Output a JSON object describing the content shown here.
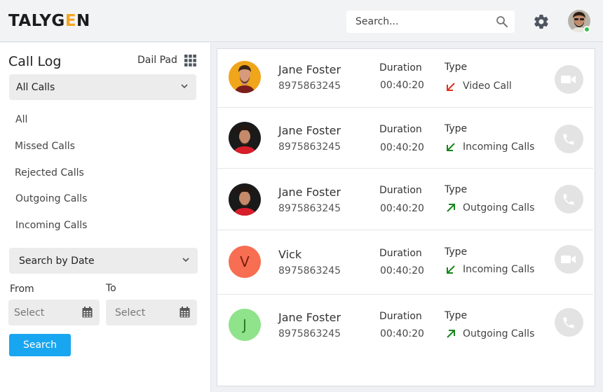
{
  "header": {
    "logo_pre": "TALYG",
    "logo_accent": "E",
    "logo_post": "N",
    "search_placeholder": "Search..."
  },
  "sidebar": {
    "title": "Call Log",
    "dialpad_label": "Dail Pad",
    "call_filter_selected": "All Calls",
    "filters": [
      "All",
      "Missed Calls",
      "Rejected Calls",
      "Outgoing Calls",
      "Incoming Calls"
    ],
    "date_filter_selected": "Search by Date",
    "from_label": "From",
    "to_label": "To",
    "from_placeholder": "Select",
    "to_placeholder": "Select",
    "search_button": "Search"
  },
  "calls": [
    {
      "name": "Jane Foster",
      "phone": "8975863245",
      "duration_label": "Duration",
      "duration": "00:40:20",
      "type_label": "Type",
      "type": "Video Call",
      "arrow": "missed",
      "action_icon": "video-icon"
    },
    {
      "name": "Jane Foster",
      "phone": "8975863245",
      "duration_label": "Duration",
      "duration": "00:40:20",
      "type_label": "Type",
      "type": "Incoming Calls",
      "arrow": "incoming",
      "action_icon": "phone-icon"
    },
    {
      "name": "Jane Foster",
      "phone": "8975863245",
      "duration_label": "Duration",
      "duration": "00:40:20",
      "type_label": "Type",
      "type": "Outgoing Calls",
      "arrow": "outgoing",
      "action_icon": "phone-icon"
    },
    {
      "name": "Vick",
      "phone": "8975863245",
      "duration_label": "Duration",
      "duration": "00:40:20",
      "type_label": "Type",
      "type": "Incoming Calls",
      "arrow": "incoming",
      "action_icon": "video-icon",
      "avatar_letter": "V",
      "avatar_color": "#f76e52"
    },
    {
      "name": "Jane Foster",
      "phone": "8975863245",
      "duration_label": "Duration",
      "duration": "00:40:20",
      "type_label": "Type",
      "type": "Outgoing Calls",
      "arrow": "outgoing",
      "action_icon": "phone-icon",
      "avatar_letter": "J",
      "avatar_color": "#8fe38a"
    }
  ],
  "colors": {
    "accent": "#f5a623",
    "primary_button": "#19a6f0",
    "missed_arrow": "#e0301e",
    "incoming_arrow": "#17861b",
    "outgoing_arrow": "#17861b",
    "online": "#32c24d"
  }
}
